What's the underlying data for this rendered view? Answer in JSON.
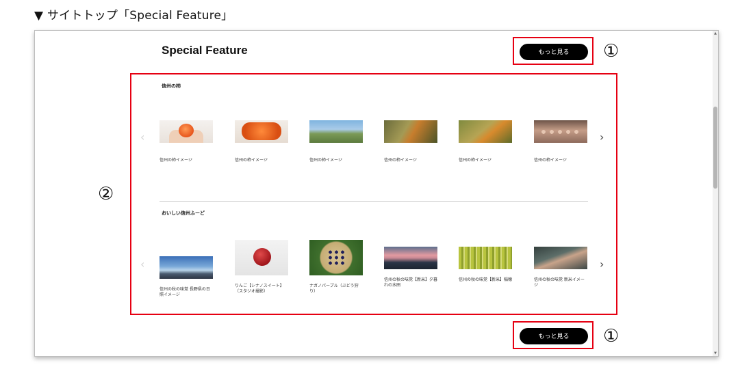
{
  "caption": "▼ サイトトップ「Special Feature」",
  "section": {
    "title": "Special Feature",
    "more_label": "もっと見る",
    "markers": {
      "top": "①",
      "middle": "②",
      "bottom": "①"
    },
    "nav": {
      "prev": "‹",
      "next": "›"
    }
  },
  "carousels": [
    {
      "title": "信州の柿",
      "items": [
        {
          "label": "信州の柿イメージ"
        },
        {
          "label": "信州の柿イメージ"
        },
        {
          "label": "信州の柿イメージ"
        },
        {
          "label": "信州の柿イメージ"
        },
        {
          "label": "信州の柿イメージ"
        },
        {
          "label": "信州の柿イメージ"
        }
      ]
    },
    {
      "title": "おいしい信州ふーど",
      "items": [
        {
          "label": "信州の秋の味覚 長野県の日照イメージ"
        },
        {
          "label": "りんご【シナノスイート】（スタジオ撮影）"
        },
        {
          "label": "ナガノパープル（ぶどう狩り）"
        },
        {
          "label": "信州の秋の味覚【新米】夕暮れの水田"
        },
        {
          "label": "信州の秋の味覚【新米】稲穂"
        },
        {
          "label": "信州の秋の味覚 新米イメージ"
        }
      ]
    }
  ],
  "colors": {
    "highlight": "#e60012",
    "button": "#000000"
  },
  "icons": {
    "prev": "chevron-left-icon",
    "next": "chevron-right-icon"
  }
}
